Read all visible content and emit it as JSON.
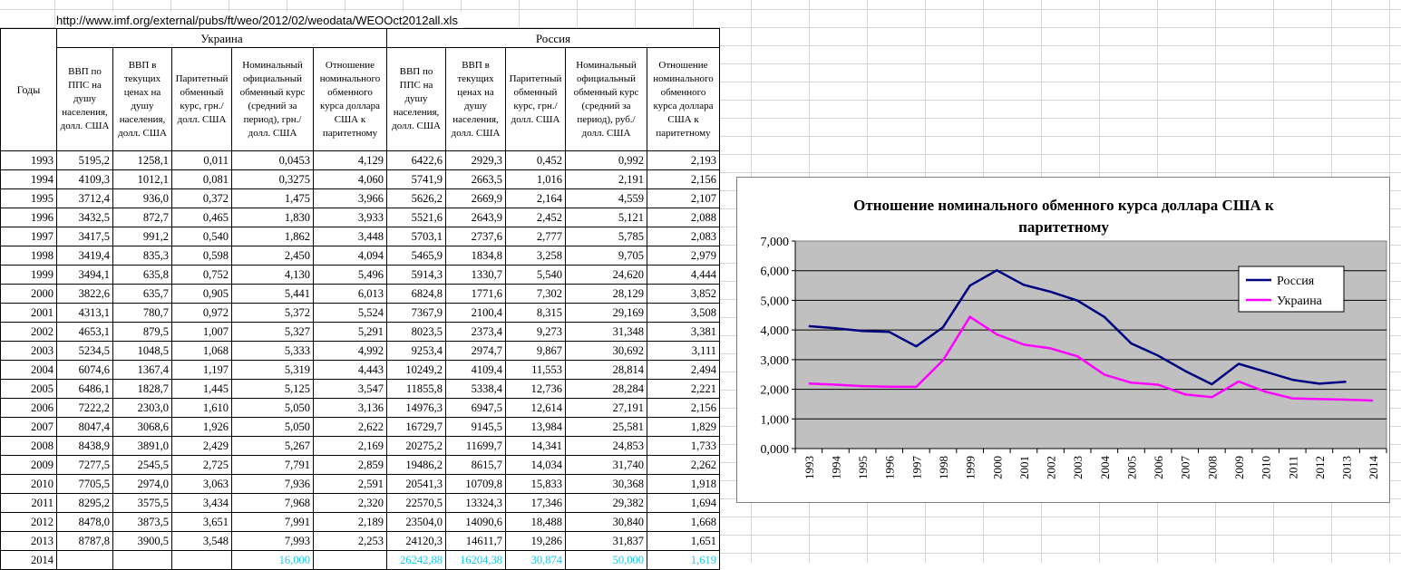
{
  "source_url": "http://www.imf.org/external/pubs/ft/weo/2012/02/weodata/WEOOct2012all.xls",
  "table": {
    "years_header": "Годы",
    "countries": [
      "Украина",
      "Россия"
    ],
    "ukraine_headers": [
      "ВВП по ППС на душу населения, долл. США",
      "ВВП в текущих ценах на душу населения, долл. США",
      "Паритетный обменный курс, грн./долл. США",
      "Номинальный официальный обменный курс (средний за период), грн./долл. США",
      "Отношение номинального обменного курса доллара США к паритетному"
    ],
    "russia_headers": [
      "ВВП по ППС на душу населения, долл. США",
      "ВВП в текущих ценах на душу населения, долл. США",
      "Паритетный обменный курс, грн./долл. США",
      "Номинальный официальный обменный курс (средний за период), руб./долл. США",
      "Отношение номинального обменного курса доллара США к паритетному"
    ],
    "rows": [
      [
        "1993",
        "5195,2",
        "1258,1",
        "0,011",
        "0,0453",
        "4,129",
        "6422,6",
        "2929,3",
        "0,452",
        "0,992",
        "2,193"
      ],
      [
        "1994",
        "4109,3",
        "1012,1",
        "0,081",
        "0,3275",
        "4,060",
        "5741,9",
        "2663,5",
        "1,016",
        "2,191",
        "2,156"
      ],
      [
        "1995",
        "3712,4",
        "936,0",
        "0,372",
        "1,475",
        "3,966",
        "5626,2",
        "2669,9",
        "2,164",
        "4,559",
        "2,107"
      ],
      [
        "1996",
        "3432,5",
        "872,7",
        "0,465",
        "1,830",
        "3,933",
        "5521,6",
        "2643,9",
        "2,452",
        "5,121",
        "2,088"
      ],
      [
        "1997",
        "3417,5",
        "991,2",
        "0,540",
        "1,862",
        "3,448",
        "5703,1",
        "2737,6",
        "2,777",
        "5,785",
        "2,083"
      ],
      [
        "1998",
        "3419,4",
        "835,3",
        "0,598",
        "2,450",
        "4,094",
        "5465,9",
        "1834,8",
        "3,258",
        "9,705",
        "2,979"
      ],
      [
        "1999",
        "3494,1",
        "635,8",
        "0,752",
        "4,130",
        "5,496",
        "5914,3",
        "1330,7",
        "5,540",
        "24,620",
        "4,444"
      ],
      [
        "2000",
        "3822,6",
        "635,7",
        "0,905",
        "5,441",
        "6,013",
        "6824,8",
        "1771,6",
        "7,302",
        "28,129",
        "3,852"
      ],
      [
        "2001",
        "4313,1",
        "780,7",
        "0,972",
        "5,372",
        "5,524",
        "7367,9",
        "2100,4",
        "8,315",
        "29,169",
        "3,508"
      ],
      [
        "2002",
        "4653,1",
        "879,5",
        "1,007",
        "5,327",
        "5,291",
        "8023,5",
        "2373,4",
        "9,273",
        "31,348",
        "3,381"
      ],
      [
        "2003",
        "5234,5",
        "1048,5",
        "1,068",
        "5,333",
        "4,992",
        "9253,4",
        "2974,7",
        "9,867",
        "30,692",
        "3,111"
      ],
      [
        "2004",
        "6074,6",
        "1367,4",
        "1,197",
        "5,319",
        "4,443",
        "10249,2",
        "4109,4",
        "11,553",
        "28,814",
        "2,494"
      ],
      [
        "2005",
        "6486,1",
        "1828,7",
        "1,445",
        "5,125",
        "3,547",
        "11855,8",
        "5338,4",
        "12,736",
        "28,284",
        "2,221"
      ],
      [
        "2006",
        "7222,2",
        "2303,0",
        "1,610",
        "5,050",
        "3,136",
        "14976,3",
        "6947,5",
        "12,614",
        "27,191",
        "2,156"
      ],
      [
        "2007",
        "8047,4",
        "3068,6",
        "1,926",
        "5,050",
        "2,622",
        "16729,7",
        "9145,5",
        "13,984",
        "25,581",
        "1,829"
      ],
      [
        "2008",
        "8438,9",
        "3891,0",
        "2,429",
        "5,267",
        "2,169",
        "20275,2",
        "11699,7",
        "14,341",
        "24,853",
        "1,733"
      ],
      [
        "2009",
        "7277,5",
        "2545,5",
        "2,725",
        "7,791",
        "2,859",
        "19486,2",
        "8615,7",
        "14,034",
        "31,740",
        "2,262"
      ],
      [
        "2010",
        "7705,5",
        "2974,0",
        "3,063",
        "7,936",
        "2,591",
        "20541,3",
        "10709,8",
        "15,833",
        "30,368",
        "1,918"
      ],
      [
        "2011",
        "8295,2",
        "3575,5",
        "3,434",
        "7,968",
        "2,320",
        "22570,5",
        "13324,3",
        "17,346",
        "29,382",
        "1,694"
      ],
      [
        "2012",
        "8478,0",
        "3873,5",
        "3,651",
        "7,991",
        "2,189",
        "23504,0",
        "14090,6",
        "18,488",
        "30,840",
        "1,668"
      ],
      [
        "2013",
        "8787,8",
        "3900,5",
        "3,548",
        "7,993",
        "2,253",
        "24120,3",
        "14611,7",
        "19,286",
        "31,837",
        "1,651"
      ],
      [
        "2014",
        "",
        "",
        "",
        "16,000",
        "",
        "26242,88",
        "16204,38",
        "30,874",
        "50,000",
        "1,619"
      ]
    ],
    "projected_color": "#1ec8ea"
  },
  "chart_data": {
    "type": "line",
    "title": "Отношение номинального обменного курса доллара США к паритетному",
    "categories": [
      "1993",
      "1994",
      "1995",
      "1996",
      "1997",
      "1998",
      "1999",
      "2000",
      "2001",
      "2002",
      "2003",
      "2004",
      "2005",
      "2006",
      "2007",
      "2008",
      "2009",
      "2010",
      "2011",
      "2012",
      "2013",
      "2014"
    ],
    "series": [
      {
        "name": "Россия",
        "color": "#000080",
        "values": [
          4.129,
          4.06,
          3.966,
          3.933,
          3.448,
          4.094,
          5.496,
          6.013,
          5.524,
          5.291,
          4.992,
          4.443,
          3.547,
          3.136,
          2.622,
          2.169,
          2.859,
          2.591,
          2.32,
          2.189,
          2.253,
          null
        ]
      },
      {
        "name": "Украина",
        "color": "#ff00ff",
        "values": [
          2.193,
          2.156,
          2.107,
          2.088,
          2.083,
          2.979,
          4.444,
          3.852,
          3.508,
          3.381,
          3.111,
          2.494,
          2.221,
          2.156,
          1.829,
          1.733,
          2.262,
          1.918,
          1.694,
          1.668,
          1.651,
          1.619
        ]
      }
    ],
    "ylim": [
      0,
      7
    ],
    "yticks": [
      "0,000",
      "1,000",
      "2,000",
      "3,000",
      "4,000",
      "5,000",
      "6,000",
      "7,000"
    ],
    "grid": true,
    "legend": "top-right",
    "plot_background": "#c0c0c0"
  }
}
